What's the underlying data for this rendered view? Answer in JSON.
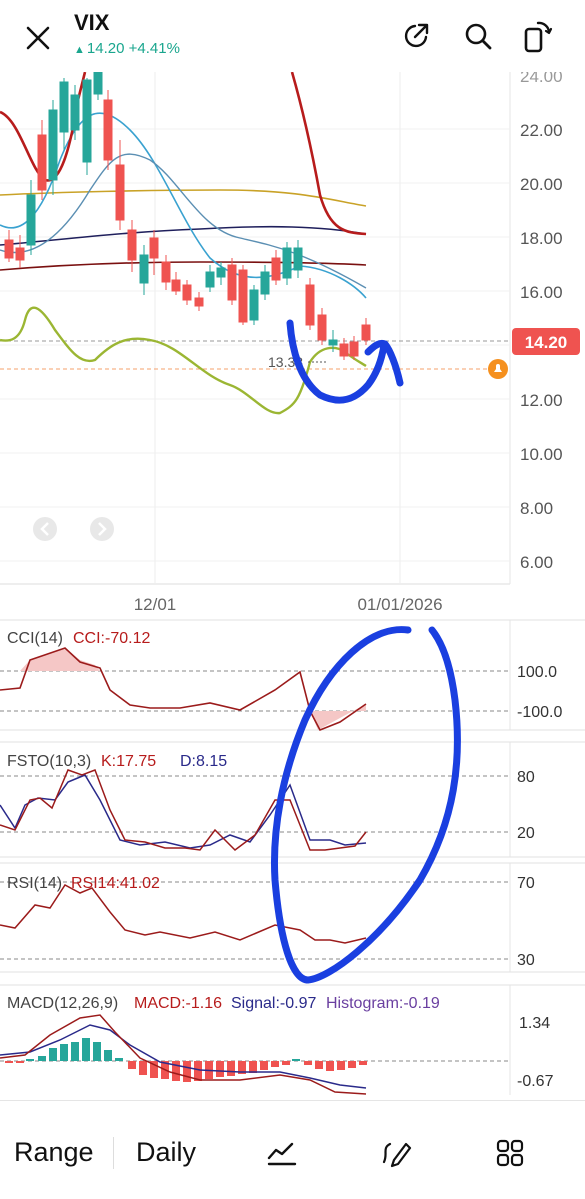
{
  "header": {
    "title": "VIX",
    "price": "14.20",
    "change": "+4.41%",
    "close_icon": "close-icon",
    "share_icon": "share-icon",
    "search_icon": "search-icon",
    "rotate_icon": "rotate-icon"
  },
  "price_axis": {
    "labels": [
      "22.00",
      "20.00",
      "18.00",
      "16.00",
      "12.00",
      "10.00",
      "8.00",
      "6.00"
    ],
    "current_price_badge": "14.20",
    "low_marker": "13.38"
  },
  "date_axis": {
    "labels": [
      "12/01",
      "01/01/2026"
    ]
  },
  "panels": {
    "cci": {
      "name": "CCI(14)",
      "value": "CCI:-70.12",
      "levels": [
        "100.0",
        "-100.0"
      ]
    },
    "fsto": {
      "name": "FSTO(10,3)",
      "k": "K:17.75",
      "d": "D:8.15",
      "levels": [
        "80",
        "20"
      ]
    },
    "rsi": {
      "name": "RSI(14)",
      "value": "RSI14:41.02",
      "levels": [
        "70",
        "30"
      ]
    },
    "macd": {
      "name": "MACD(12,26,9)",
      "macd": "MACD:-1.16",
      "signal": "Signal:-0.97",
      "histogram": "Histogram:-0.19",
      "levels": [
        "1.34",
        "-0.67"
      ]
    }
  },
  "bottom_bar": {
    "range_label": "Range",
    "interval_label": "Daily",
    "indicator_icon": "indicator-icon",
    "draw_icon": "draw-icon",
    "layout_icon": "grid-icon"
  },
  "colors": {
    "up": "#26a69a",
    "down": "#ef5350",
    "price_badge": "#ef5350",
    "handdrawn": "#1a3fe0",
    "quote": "#1aa68e"
  }
}
